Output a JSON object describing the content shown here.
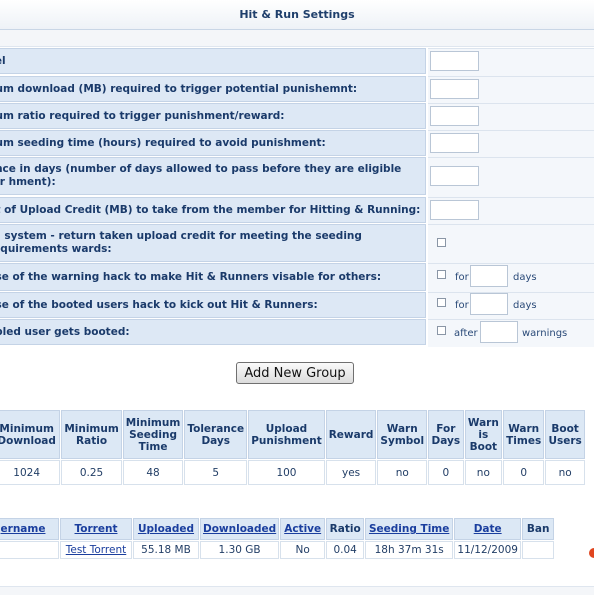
{
  "title": "Hit & Run Settings",
  "settings": [
    {
      "label": "vel",
      "control": "text"
    },
    {
      "label": "num download (MB) required to trigger potential punishemnt:",
      "control": "text"
    },
    {
      "label": "num ratio required to trigger punishment/reward:",
      "control": "text"
    },
    {
      "label": "num seeding time (hours) required to avoid punishment:",
      "control": "text"
    },
    {
      "label": "ance in days (number of days allowed to pass before they are eligible for hment):",
      "control": "text"
    },
    {
      "label": "nt of Upload Credit (MB) to take from the member for Hitting & Running:",
      "control": "text"
    },
    {
      "label": "rd system - return taken upload credit for meeting the seeding requirements wards:",
      "control": "checkbox"
    },
    {
      "label": "use of the warning hack to make Hit & Runners visable for others:",
      "control": "checkbox-for",
      "pre": "for",
      "post": "days"
    },
    {
      "label": "use of the booted users hack to kick out Hit & Runners:",
      "control": "checkbox-for",
      "pre": "for",
      "post": "days"
    },
    {
      "label": "abled user gets booted:",
      "control": "checkbox-for",
      "pre": "after",
      "post": "warnings"
    }
  ],
  "add_group_button": "Add New Group",
  "groups_table": {
    "headers": [
      "Minimum Download",
      "Minimum Ratio",
      "Minimum Seeding Time",
      "Tolerance Days",
      "Upload Punishment",
      "Reward",
      "Warn Symbol",
      "For Days",
      "Warn is Boot",
      "Warn Times",
      "Boot Users"
    ],
    "row": [
      "1024",
      "0.25",
      "48",
      "5",
      "100",
      "yes",
      "no",
      "0",
      "no",
      "0",
      "no"
    ]
  },
  "users_table": {
    "headers": [
      "ername",
      "Torrent",
      "Uploaded",
      "Downloaded",
      "Active",
      "Ratio",
      "Seeding Time",
      "Date",
      "Ban"
    ],
    "row": {
      "username": "",
      "torrent": "Test Torrent",
      "uploaded": "55.18 MB",
      "downloaded": "1.30 GB",
      "active": "No",
      "ratio": "0.04",
      "seeding_time": "18h 37m 31s",
      "date": "11/12/2009"
    }
  },
  "colors": {
    "header_bg": "#dce8f5",
    "text": "#1a3a6a",
    "inactive": "#e00000"
  }
}
